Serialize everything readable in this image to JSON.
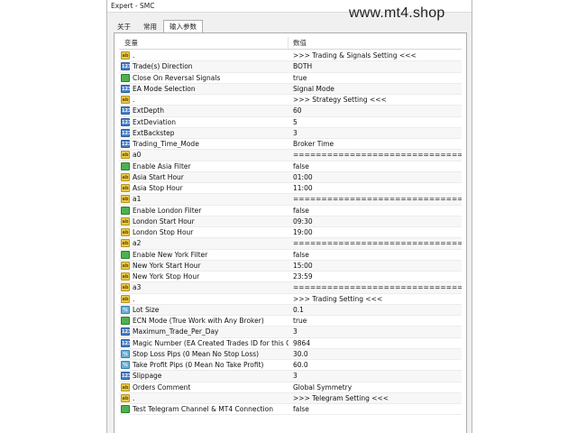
{
  "window": {
    "title": "Expert - SMC"
  },
  "watermark": "www.mt4.shop",
  "tabs": [
    {
      "label": "关于",
      "active": false
    },
    {
      "label": "常用",
      "active": false
    },
    {
      "label": "输入参数",
      "active": true
    }
  ],
  "table": {
    "headers": {
      "variable": "变量",
      "value": "数值"
    },
    "rows": [
      {
        "icon": "ab",
        "name": ".",
        "value": ">>> Trading & Signals Setting <<<"
      },
      {
        "icon": "ul",
        "name": "Trade(s) Direction",
        "value": "BOTH"
      },
      {
        "icon": "bool",
        "name": "Close On Reversal Signals",
        "value": "true"
      },
      {
        "icon": "ul",
        "name": "EA Mode Selection",
        "value": "Signal Mode"
      },
      {
        "icon": "ab",
        "name": ".",
        "value": ">>> Strategy Setting <<<"
      },
      {
        "icon": "int",
        "name": "ExtDepth",
        "value": "60"
      },
      {
        "icon": "int",
        "name": "ExtDeviation",
        "value": "5"
      },
      {
        "icon": "int",
        "name": "ExtBackstep",
        "value": "3"
      },
      {
        "icon": "ul",
        "name": "Trading_Time_Mode",
        "value": "Broker Time"
      },
      {
        "icon": "ab",
        "name": "a0",
        "value": "================================"
      },
      {
        "icon": "bool",
        "name": "Enable Asia Filter",
        "value": "false"
      },
      {
        "icon": "ab",
        "name": "Asia Start Hour",
        "value": "01:00"
      },
      {
        "icon": "ab",
        "name": "Asia Stop Hour",
        "value": "11:00"
      },
      {
        "icon": "ab",
        "name": "a1",
        "value": "================================"
      },
      {
        "icon": "bool",
        "name": "Enable London Filter",
        "value": "false"
      },
      {
        "icon": "ab",
        "name": "London Start Hour",
        "value": "09:30"
      },
      {
        "icon": "ab",
        "name": "London Stop Hour",
        "value": "19:00"
      },
      {
        "icon": "ab",
        "name": "a2",
        "value": "================================"
      },
      {
        "icon": "bool",
        "name": "Enable New York Filter",
        "value": "false"
      },
      {
        "icon": "ab",
        "name": "New York Start Hour",
        "value": "15:00"
      },
      {
        "icon": "ab",
        "name": "New York Stop Hour",
        "value": "23:59"
      },
      {
        "icon": "ab",
        "name": "a3",
        "value": "================================"
      },
      {
        "icon": "ab",
        "name": ".",
        "value": ">>> Trading Setting <<<"
      },
      {
        "icon": "dbl",
        "name": "Lot Size",
        "value": "0.1"
      },
      {
        "icon": "bool",
        "name": "ECN Mode (True Work with Any Broker)",
        "value": "true"
      },
      {
        "icon": "int",
        "name": "Maximum_Trade_Per_Day",
        "value": "3"
      },
      {
        "icon": "int",
        "name": "Magic Number (EA Created Trades ID for this Ch...",
        "value": "9864"
      },
      {
        "icon": "dbl",
        "name": "Stop Loss Pips (0 Mean No Stop Loss)",
        "value": "30.0"
      },
      {
        "icon": "dbl",
        "name": "Take Profit Pips (0 Mean No Take Profit)",
        "value": "60.0"
      },
      {
        "icon": "int",
        "name": "Slippage",
        "value": "3"
      },
      {
        "icon": "ab",
        "name": "Orders Comment",
        "value": "Global Symmetry"
      },
      {
        "icon": "ab",
        "name": ".",
        "value": ">>> Telegram Setting <<<"
      },
      {
        "icon": "bool",
        "name": "Test Telegram Channel & MT4 Connection",
        "value": "false"
      }
    ]
  }
}
